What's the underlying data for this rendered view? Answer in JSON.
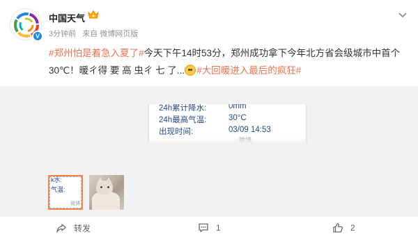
{
  "account": {
    "name": "中国天气",
    "avatar_icon": "weather-logo-icon",
    "verified_icon": "verified-badge-icon",
    "crown_icon": "crown-icon"
  },
  "meta": {
    "time": "3分钟前",
    "source": "来自 微博网页版"
  },
  "post": {
    "topic1": "#郑州怕是着急入夏了#",
    "text1": "今天下午14时53分，郑州成功拿下今年北方省会级城市中首个30℃！暖ㄔ得 要 高 虫ㄔ 七 了...",
    "emoji_icon": "astonished-emoji-icon",
    "topic2": "#大回暖进入最后的疯狂#"
  },
  "card": {
    "rows": [
      {
        "label": "24h累计降水:",
        "value": "0mm"
      },
      {
        "label": "24h最高气温:",
        "value": "30°C"
      },
      {
        "label": "出现时间:",
        "value": "03/09 14:53"
      }
    ],
    "watermark": "微博"
  },
  "thumb1": {
    "line1": "k水:",
    "line2": "气温:",
    "watermark": "微博"
  },
  "actions": {
    "share_label": "转发",
    "comment_count": "1",
    "like_count": "2"
  },
  "colors": {
    "topic": "#eb7350",
    "selected_thumb_border": "#ff8140",
    "card_text": "#2a4a8a"
  }
}
